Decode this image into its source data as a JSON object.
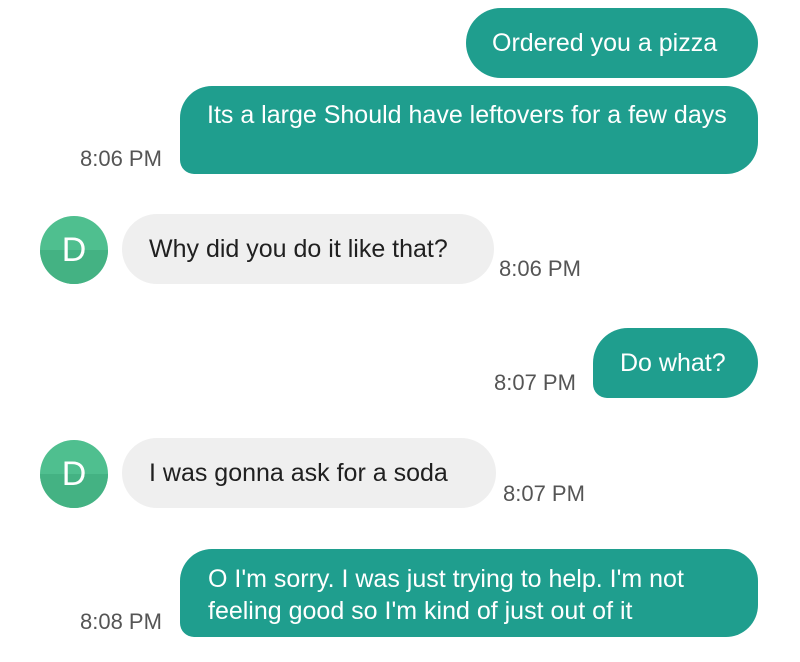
{
  "messages": [
    {
      "direction": "outgoing",
      "text": "Ordered you a pizza",
      "time": ""
    },
    {
      "direction": "outgoing",
      "text": "Its a large Should have leftovers for a few days",
      "time": "8:06 PM"
    },
    {
      "direction": "incoming",
      "avatar": "D",
      "text": "Why did you do it like that?",
      "time": "8:06 PM"
    },
    {
      "direction": "outgoing",
      "text": "Do what?",
      "time": "8:07 PM"
    },
    {
      "direction": "incoming",
      "avatar": "D",
      "text": "I was gonna ask for a soda",
      "time": "8:07 PM"
    },
    {
      "direction": "outgoing",
      "text": "O I'm sorry. I was just trying to help.  I'm not feeling good so I'm kind of just out of it",
      "time": "8:08 PM"
    }
  ],
  "colors": {
    "outgoing_bubble": "#1f9e8e",
    "incoming_bubble": "#efefef",
    "avatar": "#4fbf8f"
  }
}
